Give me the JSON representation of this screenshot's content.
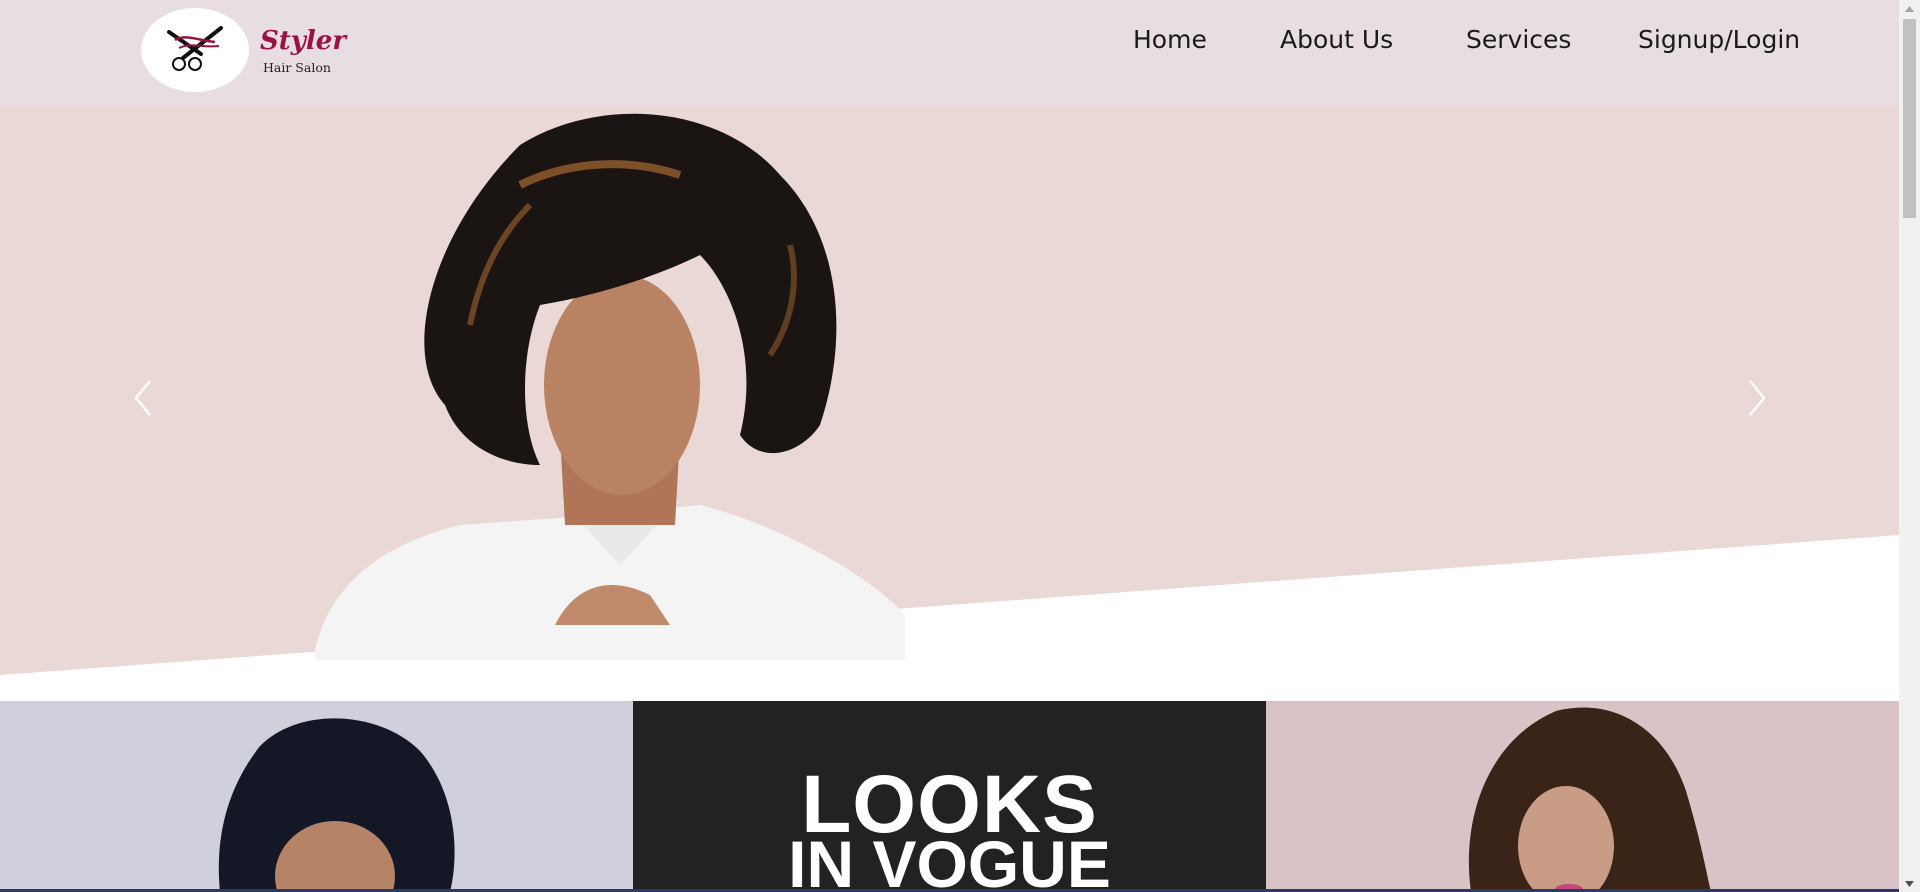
{
  "brand": {
    "name": "Styler",
    "subtitle": "Hair Salon"
  },
  "nav": {
    "items": [
      {
        "label": "Home"
      },
      {
        "label": "About Us"
      },
      {
        "label": "Services"
      },
      {
        "label": "Signup/Login"
      }
    ]
  },
  "hero": {
    "prev_icon": "chevron-left-icon",
    "next_icon": "chevron-right-icon"
  },
  "tiles": {
    "center_line1": "LOOKS",
    "center_line2": "IN VOGUE"
  },
  "colors": {
    "nav_bg": "#e7dde2",
    "brand": "#9a1340",
    "hero_bg": "#ead8d6",
    "tile_dark": "#222222"
  }
}
